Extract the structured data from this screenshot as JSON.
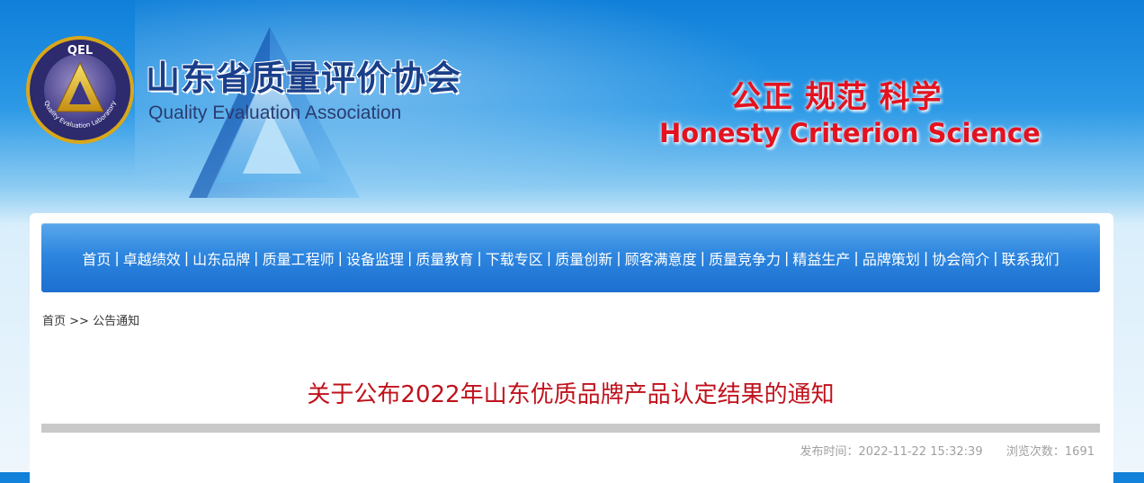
{
  "header": {
    "logo_text": "QEL",
    "logo_ring_text": "Quality Evaluation Laboratory",
    "title": "山东省质量评价协会",
    "subtitle": "Quality Evaluation Association",
    "slogan_cn": "公正 规范 科学",
    "slogan_en": "Honesty Criterion Science"
  },
  "nav": {
    "items": [
      {
        "label": "首页"
      },
      {
        "label": "卓越绩效"
      },
      {
        "label": "山东品牌"
      },
      {
        "label": "质量工程师"
      },
      {
        "label": "设备监理"
      },
      {
        "label": "质量教育"
      },
      {
        "label": "下载专区"
      },
      {
        "label": "质量创新"
      },
      {
        "label": "顾客满意度"
      },
      {
        "label": "质量竞争力"
      },
      {
        "label": "精益生产"
      },
      {
        "label": "品牌策划"
      },
      {
        "label": "协会简介"
      },
      {
        "label": "联系我们"
      }
    ],
    "separator": "|"
  },
  "breadcrumb": {
    "home": "首页",
    "arrow": ">>",
    "current": "公告通知"
  },
  "article": {
    "title": "关于公布2022年山东优质品牌产品认定结果的通知",
    "publish_label": "发布时间：",
    "publish_time": "2022-11-22 15:32:39",
    "views_label": "浏览次数：",
    "views": "1691"
  },
  "colors": {
    "header_blue": "#1a86dd",
    "nav_blue": "#2d86df",
    "title_red": "#c0121c",
    "slogan_red": "#e4121f"
  }
}
